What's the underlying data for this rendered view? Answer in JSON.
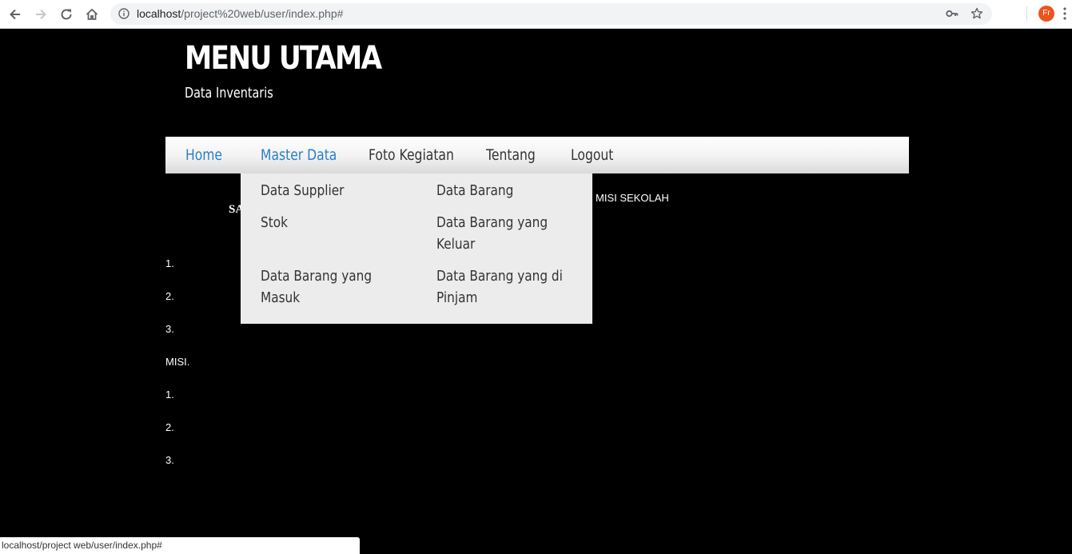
{
  "browser": {
    "url_host": "localhost",
    "url_path": "/project%20web/user/index.php#",
    "profile_initials": "Fr",
    "icons": {
      "back": "arrow-left-icon",
      "forward": "arrow-right-icon",
      "reload": "reload-icon",
      "home": "home-icon",
      "info": "info-icon",
      "key": "key-icon",
      "bookmark": "star-icon",
      "menu": "kebab-menu-icon"
    },
    "colors": {
      "omnibox_bg": "#f1f3f4",
      "avatar_bg": "#e8551f"
    }
  },
  "header": {
    "title": "MENU UTAMA",
    "subtitle": "Data Inventaris"
  },
  "nav": {
    "items": [
      {
        "label": "Home"
      },
      {
        "label": "Master Data"
      },
      {
        "label": "Foto Kegiatan"
      },
      {
        "label": "Tentang"
      },
      {
        "label": "Logout"
      }
    ],
    "active_color": "#2a7fc9"
  },
  "dropdown": {
    "items": [
      {
        "label": "Data Supplier"
      },
      {
        "label": "Data Barang"
      },
      {
        "label": "Stok"
      },
      {
        "label": "Data Barang yang Keluar"
      },
      {
        "label": "Data Barang yang Masuk"
      },
      {
        "label": "Data Barang yang di Pinjam"
      }
    ],
    "background": "#ececec"
  },
  "content": {
    "heading_partial": "SA",
    "heading_right": "MISI SEKOLAH",
    "visi_list": [
      "1.",
      "2.",
      "3."
    ],
    "misi_label": "MISI.",
    "misi_list": [
      "1.",
      "2.",
      "3."
    ]
  },
  "status_bar": {
    "text": "localhost/project web/user/index.php#"
  }
}
